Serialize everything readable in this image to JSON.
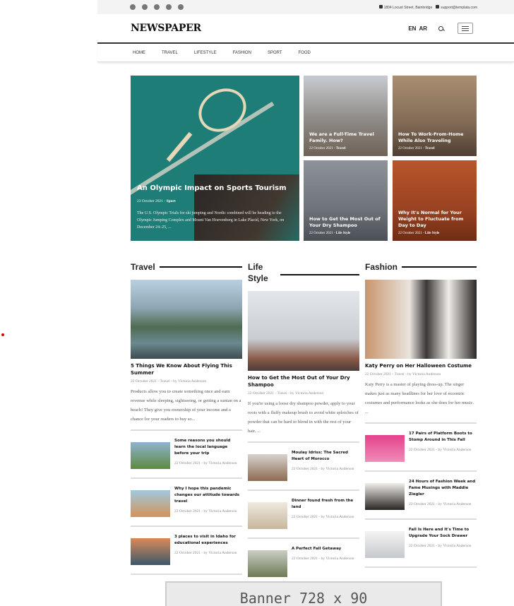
{
  "topbar": {
    "address": "1804 Locust Street, Bainbridge",
    "email": "support@templata.com"
  },
  "header": {
    "logo": "NEWSPAPER",
    "lang_en": "EN",
    "lang_ar": "AR"
  },
  "nav": [
    "HOME",
    "TRAVEL",
    "LIFESTYLE",
    "FASHION",
    "SPORT",
    "FOOD"
  ],
  "hero": {
    "main": {
      "title": "An Olympic Impact on Sports Tourism",
      "date": "23 October 2021",
      "category": "Sport",
      "excerpt": "The U.S. Olympic Trials for ski jumping and Nordic combined will be heading to the Olympic Jumping Complex and Mount Van Hoevenberg in Lake Placid, New York, on December 24–25, ..."
    },
    "tiles": [
      {
        "title": "We are a Full-Time Travel Family. How?",
        "date": "22 October 2021",
        "category": "Travel"
      },
      {
        "title": "How To Work-From-Home While Also Traveling",
        "date": "22 October 2021",
        "category": "Travel"
      },
      {
        "title": "How to Get the Most Out of Your Dry Shampoo",
        "date": "22 October 2021",
        "category": "Life Style"
      },
      {
        "title": "Why It's Normal for Your Weight to Fluctuate from Day to Day",
        "date": "22 October 2021",
        "category": "Life Style"
      }
    ]
  },
  "columns": [
    {
      "heading": "Travel",
      "feature": {
        "title": "5 Things We Know About Flying This Summer",
        "meta": "22 October 2021 - Travel - by Victoria Anderson",
        "excerpt": "Products allow you to create something once and earn revenue while sleeping, sightseeing, or getting a suntan on a beach! They give you ownership of your income and a chance for your readers to buy so..."
      },
      "list": [
        {
          "title": "Some reasons you should learn the local language before your trip",
          "meta": "22 October 2021 - by Victoria Anderson"
        },
        {
          "title": "Why I hope this pandemic changes our attitude towards travel",
          "meta": "22 October 2021 - by Victoria Anderson"
        },
        {
          "title": "3 places to visit in Idaho for educational experiences",
          "meta": "22 October 2021 - by Victoria Anderson"
        }
      ]
    },
    {
      "heading": "Life Style",
      "feature": {
        "title": "How to Get the Most Out of Your Dry Shampoo",
        "meta": "22 October 2021 - Travel - by Victoria Anderson",
        "excerpt": "If you're using a loose dry shampoo powder, apply to your roots with a fluffy makeup brush to avoid white splotches of powder that can be hard to blend in with the rest of your hair. ..."
      },
      "list": [
        {
          "title": "Moulay Idriss: The Sacred Heart of Morocco",
          "meta": "22 October 2021 - by Victoria Anderson"
        },
        {
          "title": "Dinner found fresh from the land",
          "meta": "22 October 2021 - by Victoria Anderson"
        },
        {
          "title": "A Perfect Fall Getaway",
          "meta": "22 October 2021 - by Victoria Anderson"
        }
      ]
    },
    {
      "heading": "Fashion",
      "feature": {
        "title": "Katy Perry on Her Halloween Costume",
        "meta": "22 October 2021 - Travel - by Victoria Anderson",
        "excerpt": "Katy Perry is a master of playing dress-up. The singer makes just as many headlines for her love of eccentric costumes and performance looks as she does for her music. ..."
      },
      "list": [
        {
          "title": "17 Pairs of Platform Boots to Stomp Around in This Fall",
          "meta": "22 October 2021 - by Victoria Anderson"
        },
        {
          "title": "24 Hours of Fashion Week and Fame Musings with Maddie Ziegler",
          "meta": "22 October 2021 - by Victoria Anderson"
        },
        {
          "title": "Fall Is Here and It's Time to Upgrade Your Sock Drawer",
          "meta": "22 October 2021 - by Victoria Anderson"
        }
      ]
    }
  ],
  "banner": "Banner 728 x 90"
}
